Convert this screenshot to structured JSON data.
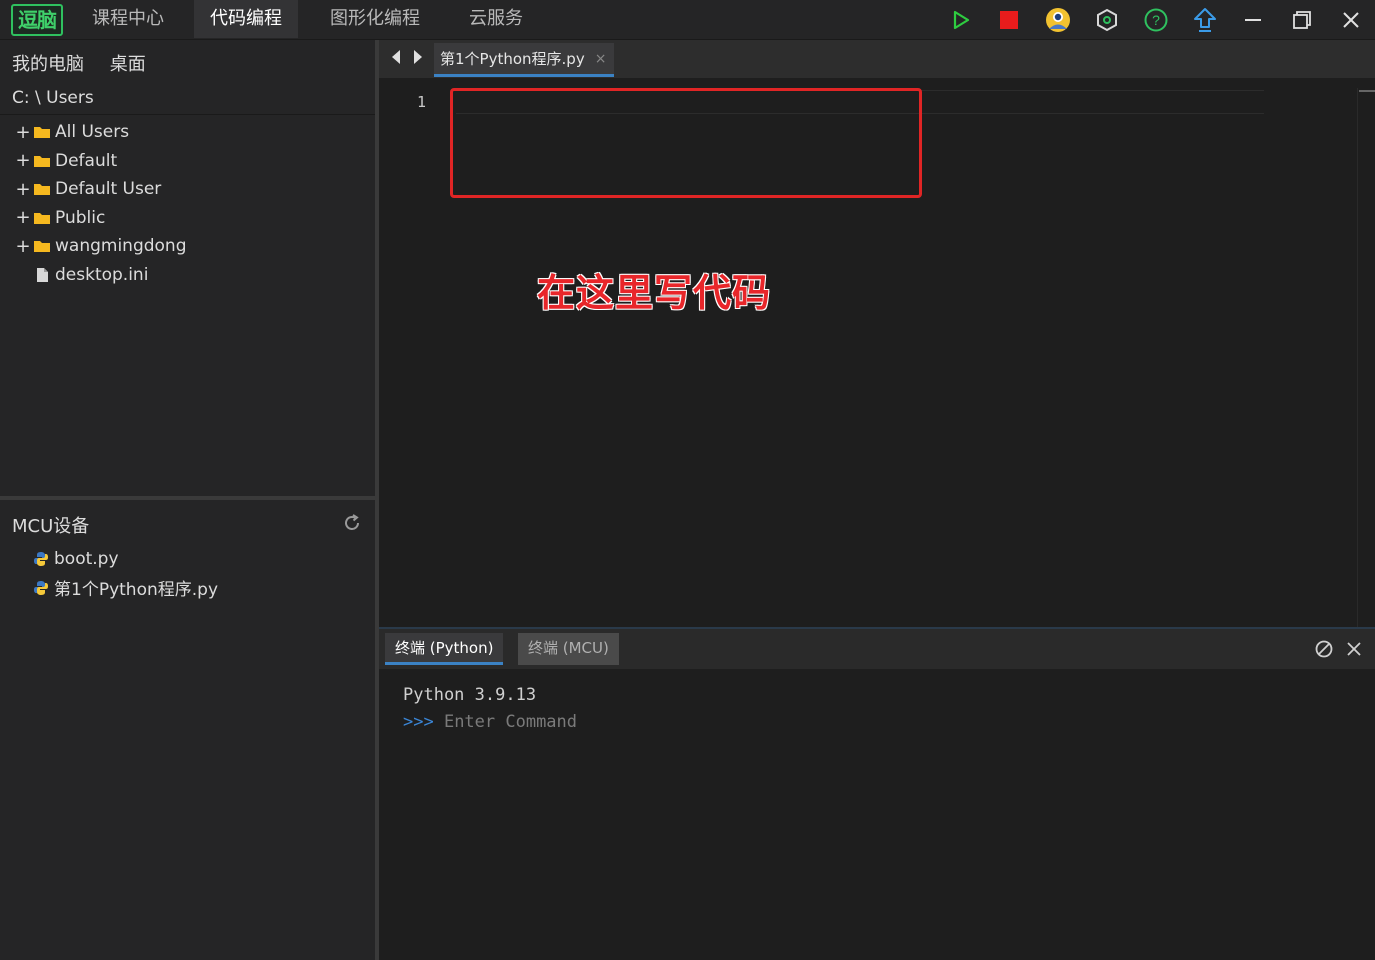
{
  "app": {
    "logo_text": "逗脑",
    "nav": [
      "课程中心",
      "代码编程",
      "图形化编程",
      "云服务"
    ],
    "active_nav": 1
  },
  "toolbar": {
    "icons": [
      "run-icon",
      "stop-icon",
      "user-avatar-icon",
      "settings-hex-icon",
      "help-icon",
      "upload-icon",
      "minimize-icon",
      "restore-icon",
      "close-icon"
    ],
    "colors": {
      "run": "#2ecc40",
      "stop": "#e81c1c",
      "help": "#2fc15f",
      "upload": "#3b9be8"
    }
  },
  "explorer": {
    "location_tabs": [
      "我的电脑",
      "桌面"
    ],
    "path": "C: \\ Users",
    "items": [
      {
        "label": "All Users",
        "type": "folder"
      },
      {
        "label": "Default",
        "type": "folder"
      },
      {
        "label": "Default User",
        "type": "folder"
      },
      {
        "label": "Public",
        "type": "folder"
      },
      {
        "label": "wangmingdong",
        "type": "folder"
      },
      {
        "label": "desktop.ini",
        "type": "file"
      }
    ]
  },
  "mcu": {
    "title": "MCU设备",
    "files": [
      "boot.py",
      "第1个Python程序.py"
    ]
  },
  "editor": {
    "tab_label": "第1个Python程序.py",
    "tab_close": "×",
    "line_number": "1",
    "annotation": "在这里写代码"
  },
  "terminal": {
    "tabs": [
      "终端 (Python)",
      "终端 (MCU)"
    ],
    "version_line": "Python 3.9.13",
    "prompt": ">>>",
    "placeholder": " Enter Command"
  }
}
